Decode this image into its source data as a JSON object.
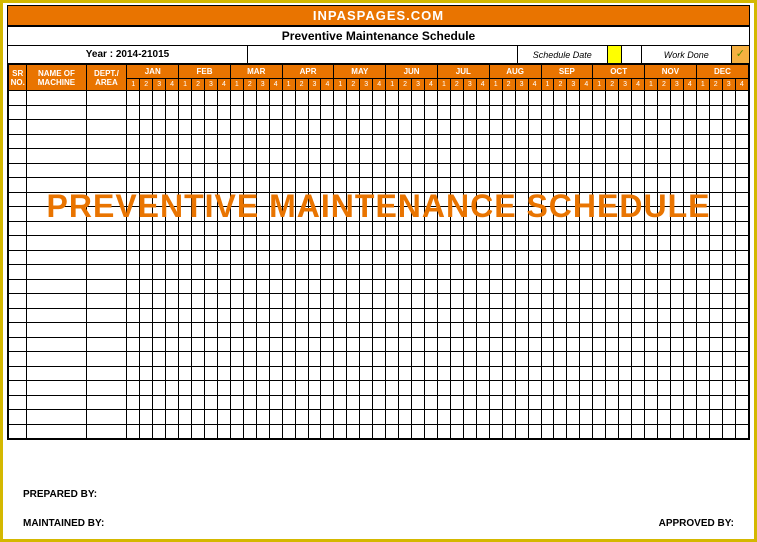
{
  "header": {
    "site": "INPASPAGES.COM",
    "title": "Preventive Maintenance Schedule"
  },
  "info": {
    "year_label": "Year : 2014-21015",
    "schedule_date_label": "Schedule Date",
    "work_done_label": "Work Done",
    "check": "✓"
  },
  "columns": {
    "sr": "SR NO.",
    "machine": "NAME OF MACHINE",
    "dept": "DEPT./ AREA"
  },
  "months": [
    "JAN",
    "FEB",
    "MAR",
    "APR",
    "MAY",
    "JUN",
    "JUL",
    "AUG",
    "SEP",
    "OCT",
    "NOV",
    "DEC"
  ],
  "weeks": [
    "1",
    "2",
    "3",
    "4"
  ],
  "watermark": "PREVENTIVE MAINTENANCE SCHEDULE",
  "footer": {
    "prepared": "PREPARED BY:",
    "maintained": "MAINTAINED BY:",
    "approved": "APPROVED BY:"
  },
  "body_row_count": 24
}
